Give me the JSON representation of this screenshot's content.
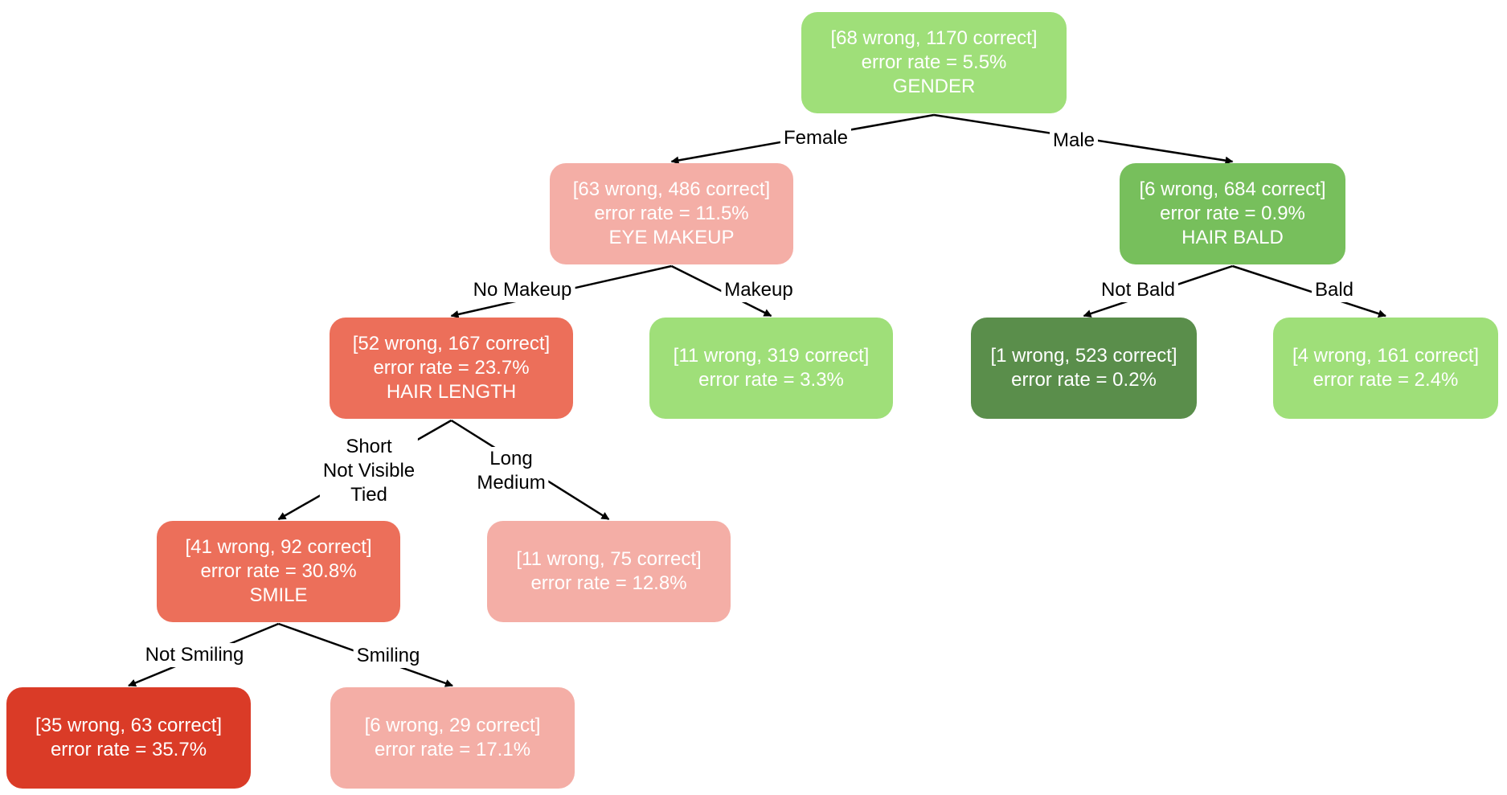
{
  "colors": {
    "light_green": "#9fdf79",
    "mid_green": "#77bf5c",
    "dark_green": "#5a8e4b",
    "pink": "#f4aea6",
    "salmon": "#ec6f5a",
    "red": "#da3b27",
    "edge": "#000000"
  },
  "nodes": [
    {
      "id": "root",
      "counts": "[68 wrong, 1170 correct]",
      "rate": "error rate = 5.5%",
      "split": "GENDER",
      "color": "light_green"
    },
    {
      "id": "female",
      "counts": "[63 wrong, 486 correct]",
      "rate": "error rate = 11.5%",
      "split": "EYE MAKEUP",
      "color": "pink"
    },
    {
      "id": "male",
      "counts": "[6 wrong, 684 correct]",
      "rate": "error rate = 0.9%",
      "split": "HAIR BALD",
      "color": "mid_green"
    },
    {
      "id": "nomakeup",
      "counts": "[52 wrong, 167 correct]",
      "rate": "error rate = 23.7%",
      "split": "HAIR LENGTH",
      "color": "salmon"
    },
    {
      "id": "makeup",
      "counts": "[11 wrong, 319 correct]",
      "rate": "error rate = 3.3%",
      "split": "",
      "color": "light_green"
    },
    {
      "id": "notbald",
      "counts": "[1 wrong, 523 correct]",
      "rate": "error rate = 0.2%",
      "split": "",
      "color": "dark_green"
    },
    {
      "id": "bald",
      "counts": "[4 wrong, 161 correct]",
      "rate": "error rate = 2.4%",
      "split": "",
      "color": "light_green"
    },
    {
      "id": "short",
      "counts": "[41 wrong, 92 correct]",
      "rate": "error rate = 30.8%",
      "split": "SMILE",
      "color": "salmon"
    },
    {
      "id": "long",
      "counts": "[11 wrong, 75 correct]",
      "rate": "error rate = 12.8%",
      "split": "",
      "color": "pink"
    },
    {
      "id": "notsmiling",
      "counts": "[35 wrong, 63 correct]",
      "rate": "error rate = 35.7%",
      "split": "",
      "color": "red"
    },
    {
      "id": "smiling",
      "counts": "[6 wrong, 29 correct]",
      "rate": "error rate = 17.1%",
      "split": "",
      "color": "pink"
    }
  ],
  "edges": [
    {
      "from": "root",
      "to": "female",
      "label": [
        "Female"
      ]
    },
    {
      "from": "root",
      "to": "male",
      "label": [
        "Male"
      ]
    },
    {
      "from": "female",
      "to": "nomakeup",
      "label": [
        "No Makeup"
      ]
    },
    {
      "from": "female",
      "to": "makeup",
      "label": [
        "Makeup"
      ]
    },
    {
      "from": "male",
      "to": "notbald",
      "label": [
        "Not Bald"
      ]
    },
    {
      "from": "male",
      "to": "bald",
      "label": [
        "Bald"
      ]
    },
    {
      "from": "nomakeup",
      "to": "short",
      "label": [
        "Short",
        "Not Visible",
        "Tied"
      ]
    },
    {
      "from": "nomakeup",
      "to": "long",
      "label": [
        "Long",
        "Medium"
      ]
    },
    {
      "from": "short",
      "to": "notsmiling",
      "label": [
        "Not Smiling"
      ]
    },
    {
      "from": "short",
      "to": "smiling",
      "label": [
        "Smiling"
      ]
    }
  ]
}
